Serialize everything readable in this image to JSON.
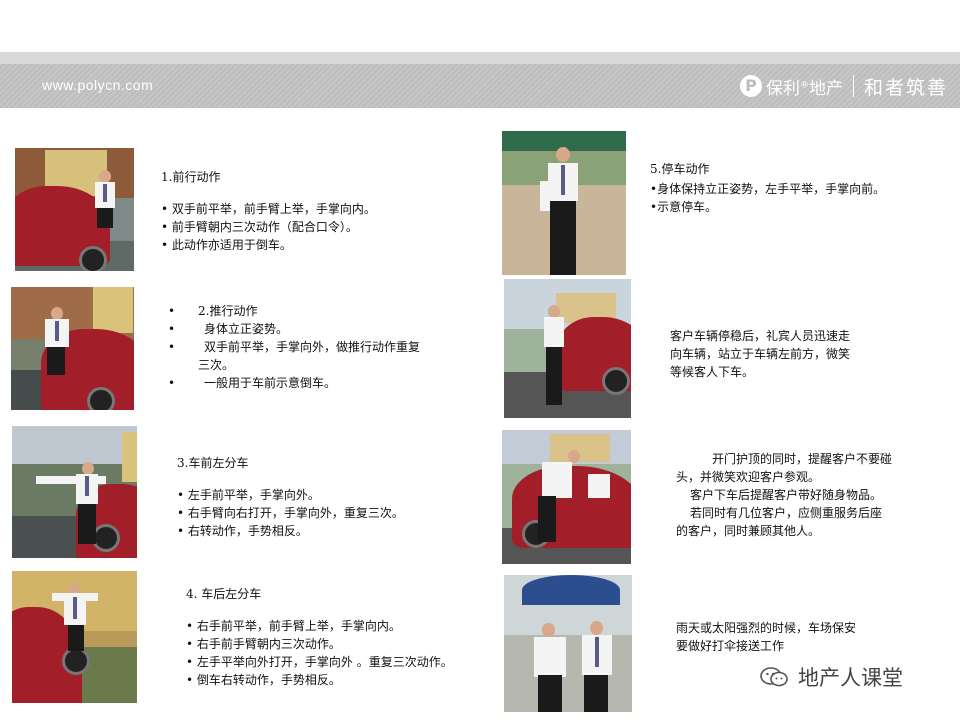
{
  "header": {
    "site": "www.polycn.com",
    "brand_logo": "P",
    "brand_name": "保利",
    "brand_reg": "®",
    "brand_suffix": "地产",
    "slogan": "和者筑善"
  },
  "left_sections": [
    {
      "title": "1.前行动作",
      "lines": [
        "• 双手前平举，前手臂上举，手掌向内。",
        "• 前手臂朝内三次动作（配合口令）。",
        "• 此动作亦适用于倒车。"
      ]
    },
    {
      "title": "2.推行动作",
      "lines": [
        "身体立正姿势。",
        "双手前平举，手掌向外，做推行动作重复",
        "三次。",
        "一般用于车前示意倒车。"
      ]
    },
    {
      "title": "3.车前左分车",
      "lines": [
        "• 左手前平举，手掌向外。",
        "• 右手臂向右打开，手掌向外，重复三次。",
        "• 右转动作，手势相反。"
      ]
    },
    {
      "title": "4. 车后左分车",
      "lines": [
        "• 右手前平举，前手臂上举，手掌向内。",
        "• 右手前手臂朝内三次动作。",
        "• 左手平举向外打开，手掌向外 。重复三次动作。",
        "• 倒车右转动作，手势相反。"
      ]
    }
  ],
  "right_sections": [
    {
      "title": "5.停车动作",
      "lines": [
        "•身体保持立正姿势，左手平举，手掌向前。",
        "•示意停车。"
      ]
    },
    {
      "lines": [
        "客户车辆停稳后，礼宾人员迅速走",
        "向车辆，站立于车辆左前方，微笑",
        "等候客人下车。"
      ]
    },
    {
      "lines": [
        "开门护顶的同时，提醒客户不要碰",
        "头，并微笑欢迎客户参观。",
        "客户下车后提醒客户带好随身物品。",
        "若同时有几位客户，应侧重服务后座",
        "的客户，同时兼顾其他人。"
      ]
    },
    {
      "lines": [
        "雨天或太阳强烈的时候，车场保安",
        "要做好打伞接送工作"
      ]
    }
  ],
  "footer": {
    "label": "地产人课堂"
  },
  "colors": {
    "header": "#c3c3c3",
    "car": "#a21f2a"
  }
}
